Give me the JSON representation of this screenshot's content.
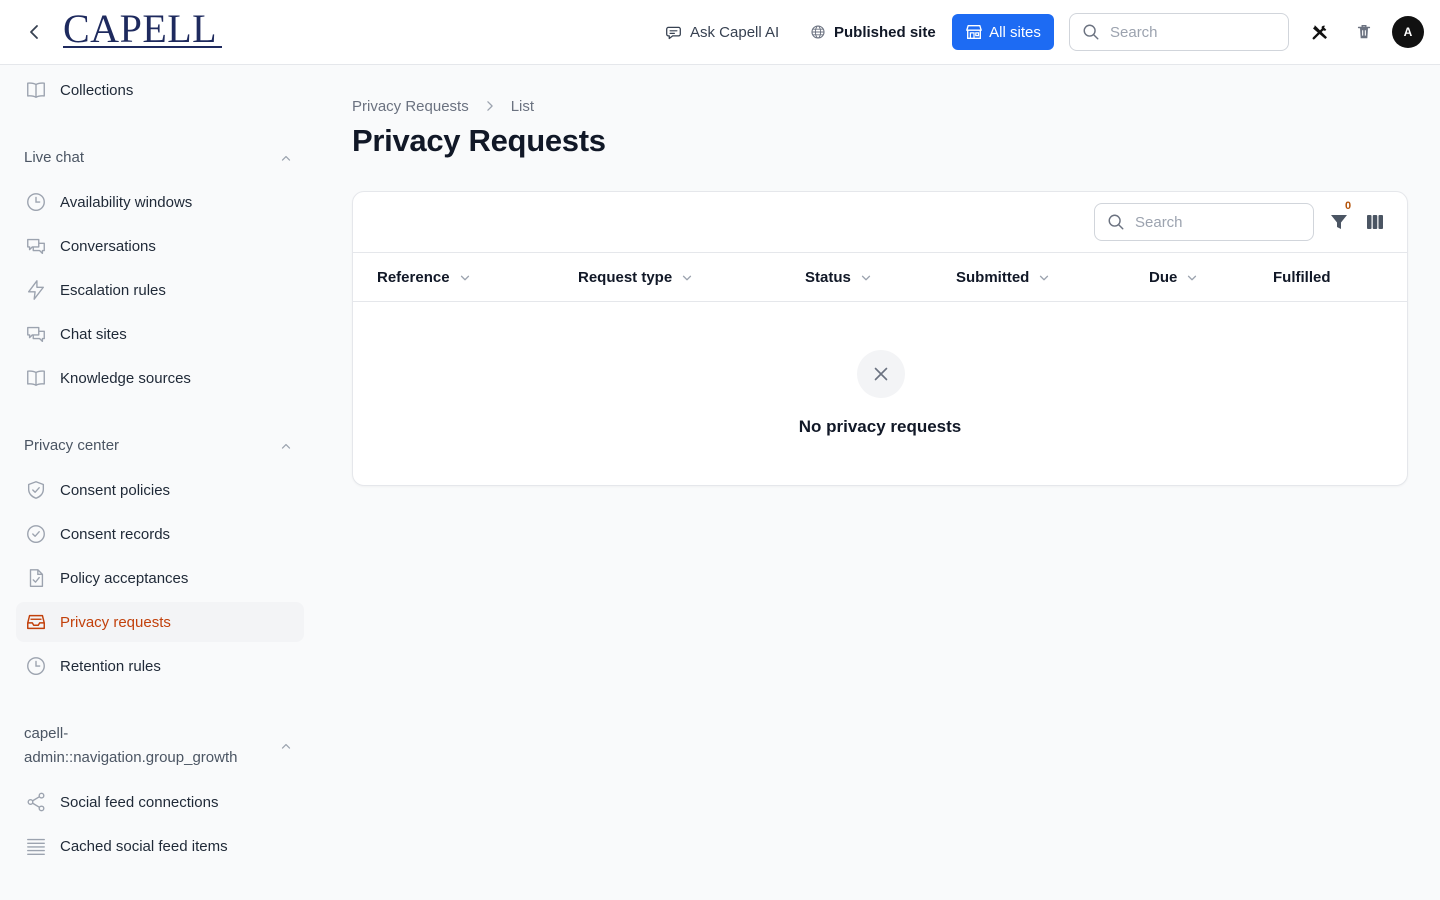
{
  "header": {
    "logo": "CAPELL",
    "ask_ai": "Ask Capell AI",
    "published_site": "Published site",
    "all_sites": "All sites",
    "search_placeholder": "Search",
    "avatar_initial": "A"
  },
  "sidebar": {
    "top_items": [
      {
        "label": "Collections",
        "icon": "book-icon"
      }
    ],
    "groups": [
      {
        "label": "Live chat",
        "items": [
          {
            "label": "Availability windows",
            "icon": "clock-icon"
          },
          {
            "label": "Conversations",
            "icon": "chat-bubbles-icon"
          },
          {
            "label": "Escalation rules",
            "icon": "bolt-icon"
          },
          {
            "label": "Chat sites",
            "icon": "chat-bubbles-icon"
          },
          {
            "label": "Knowledge sources",
            "icon": "book-icon"
          }
        ]
      },
      {
        "label": "Privacy center",
        "items": [
          {
            "label": "Consent policies",
            "icon": "shield-check-icon"
          },
          {
            "label": "Consent records",
            "icon": "check-circle-icon"
          },
          {
            "label": "Policy acceptances",
            "icon": "document-check-icon"
          },
          {
            "label": "Privacy requests",
            "icon": "inbox-stack-icon",
            "active": true
          },
          {
            "label": "Retention rules",
            "icon": "clock-icon"
          }
        ]
      },
      {
        "label": "capell-admin::navigation.group_growth",
        "items": [
          {
            "label": "Social feed connections",
            "icon": "share-icon"
          },
          {
            "label": "Cached social feed items",
            "icon": "queue-list-icon"
          }
        ]
      }
    ]
  },
  "main": {
    "breadcrumb": [
      "Privacy Requests",
      "List"
    ],
    "title": "Privacy Requests",
    "table": {
      "search_placeholder": "Search",
      "filter_count": "0",
      "columns": [
        "Reference",
        "Request type",
        "Status",
        "Submitted",
        "Due",
        "Fulfilled"
      ],
      "empty_text": "No privacy requests"
    }
  },
  "colors": {
    "accent": "#1d6bf3",
    "active_nav": "#c2410c",
    "logo": "#1e2a5e"
  }
}
